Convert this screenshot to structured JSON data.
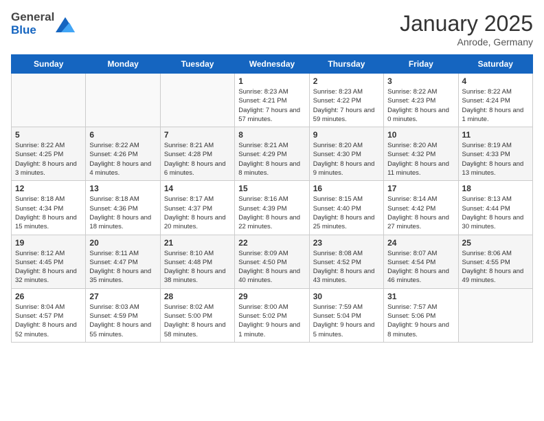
{
  "app": {
    "name_general": "General",
    "name_blue": "Blue"
  },
  "title": "January 2025",
  "location": "Anrode, Germany",
  "days_of_week": [
    "Sunday",
    "Monday",
    "Tuesday",
    "Wednesday",
    "Thursday",
    "Friday",
    "Saturday"
  ],
  "weeks": [
    [
      {
        "day": "",
        "info": ""
      },
      {
        "day": "",
        "info": ""
      },
      {
        "day": "",
        "info": ""
      },
      {
        "day": "1",
        "info": "Sunrise: 8:23 AM\nSunset: 4:21 PM\nDaylight: 7 hours and 57 minutes."
      },
      {
        "day": "2",
        "info": "Sunrise: 8:23 AM\nSunset: 4:22 PM\nDaylight: 7 hours and 59 minutes."
      },
      {
        "day": "3",
        "info": "Sunrise: 8:22 AM\nSunset: 4:23 PM\nDaylight: 8 hours and 0 minutes."
      },
      {
        "day": "4",
        "info": "Sunrise: 8:22 AM\nSunset: 4:24 PM\nDaylight: 8 hours and 1 minute."
      }
    ],
    [
      {
        "day": "5",
        "info": "Sunrise: 8:22 AM\nSunset: 4:25 PM\nDaylight: 8 hours and 3 minutes."
      },
      {
        "day": "6",
        "info": "Sunrise: 8:22 AM\nSunset: 4:26 PM\nDaylight: 8 hours and 4 minutes."
      },
      {
        "day": "7",
        "info": "Sunrise: 8:21 AM\nSunset: 4:28 PM\nDaylight: 8 hours and 6 minutes."
      },
      {
        "day": "8",
        "info": "Sunrise: 8:21 AM\nSunset: 4:29 PM\nDaylight: 8 hours and 8 minutes."
      },
      {
        "day": "9",
        "info": "Sunrise: 8:20 AM\nSunset: 4:30 PM\nDaylight: 8 hours and 9 minutes."
      },
      {
        "day": "10",
        "info": "Sunrise: 8:20 AM\nSunset: 4:32 PM\nDaylight: 8 hours and 11 minutes."
      },
      {
        "day": "11",
        "info": "Sunrise: 8:19 AM\nSunset: 4:33 PM\nDaylight: 8 hours and 13 minutes."
      }
    ],
    [
      {
        "day": "12",
        "info": "Sunrise: 8:18 AM\nSunset: 4:34 PM\nDaylight: 8 hours and 15 minutes."
      },
      {
        "day": "13",
        "info": "Sunrise: 8:18 AM\nSunset: 4:36 PM\nDaylight: 8 hours and 18 minutes."
      },
      {
        "day": "14",
        "info": "Sunrise: 8:17 AM\nSunset: 4:37 PM\nDaylight: 8 hours and 20 minutes."
      },
      {
        "day": "15",
        "info": "Sunrise: 8:16 AM\nSunset: 4:39 PM\nDaylight: 8 hours and 22 minutes."
      },
      {
        "day": "16",
        "info": "Sunrise: 8:15 AM\nSunset: 4:40 PM\nDaylight: 8 hours and 25 minutes."
      },
      {
        "day": "17",
        "info": "Sunrise: 8:14 AM\nSunset: 4:42 PM\nDaylight: 8 hours and 27 minutes."
      },
      {
        "day": "18",
        "info": "Sunrise: 8:13 AM\nSunset: 4:44 PM\nDaylight: 8 hours and 30 minutes."
      }
    ],
    [
      {
        "day": "19",
        "info": "Sunrise: 8:12 AM\nSunset: 4:45 PM\nDaylight: 8 hours and 32 minutes."
      },
      {
        "day": "20",
        "info": "Sunrise: 8:11 AM\nSunset: 4:47 PM\nDaylight: 8 hours and 35 minutes."
      },
      {
        "day": "21",
        "info": "Sunrise: 8:10 AM\nSunset: 4:48 PM\nDaylight: 8 hours and 38 minutes."
      },
      {
        "day": "22",
        "info": "Sunrise: 8:09 AM\nSunset: 4:50 PM\nDaylight: 8 hours and 40 minutes."
      },
      {
        "day": "23",
        "info": "Sunrise: 8:08 AM\nSunset: 4:52 PM\nDaylight: 8 hours and 43 minutes."
      },
      {
        "day": "24",
        "info": "Sunrise: 8:07 AM\nSunset: 4:54 PM\nDaylight: 8 hours and 46 minutes."
      },
      {
        "day": "25",
        "info": "Sunrise: 8:06 AM\nSunset: 4:55 PM\nDaylight: 8 hours and 49 minutes."
      }
    ],
    [
      {
        "day": "26",
        "info": "Sunrise: 8:04 AM\nSunset: 4:57 PM\nDaylight: 8 hours and 52 minutes."
      },
      {
        "day": "27",
        "info": "Sunrise: 8:03 AM\nSunset: 4:59 PM\nDaylight: 8 hours and 55 minutes."
      },
      {
        "day": "28",
        "info": "Sunrise: 8:02 AM\nSunset: 5:00 PM\nDaylight: 8 hours and 58 minutes."
      },
      {
        "day": "29",
        "info": "Sunrise: 8:00 AM\nSunset: 5:02 PM\nDaylight: 9 hours and 1 minute."
      },
      {
        "day": "30",
        "info": "Sunrise: 7:59 AM\nSunset: 5:04 PM\nDaylight: 9 hours and 5 minutes."
      },
      {
        "day": "31",
        "info": "Sunrise: 7:57 AM\nSunset: 5:06 PM\nDaylight: 9 hours and 8 minutes."
      },
      {
        "day": "",
        "info": ""
      }
    ]
  ]
}
